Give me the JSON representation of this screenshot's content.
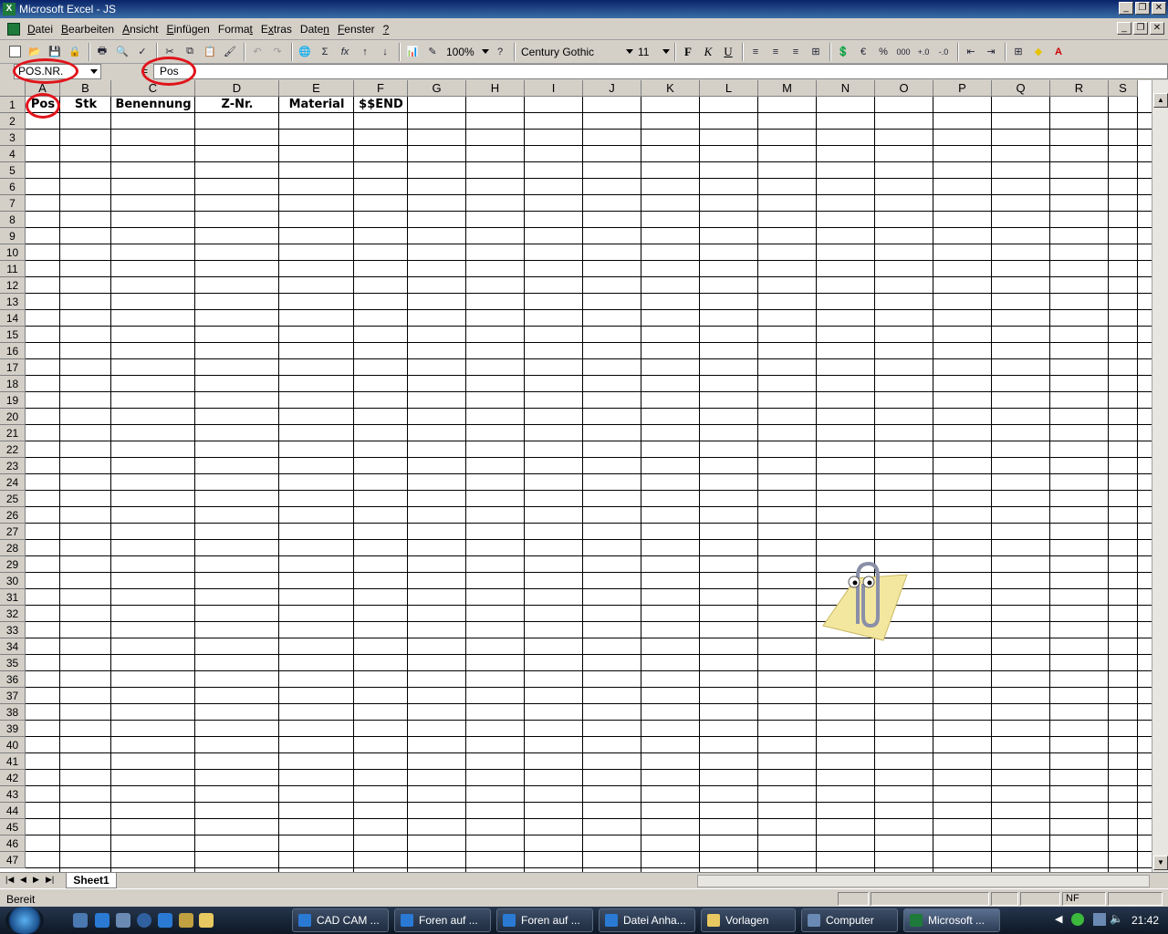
{
  "window": {
    "title": "Microsoft Excel - JS"
  },
  "menu": {
    "items": [
      {
        "pre": "",
        "u": "D",
        "post": "atei"
      },
      {
        "pre": "",
        "u": "B",
        "post": "earbeiten"
      },
      {
        "pre": "",
        "u": "A",
        "post": "nsicht"
      },
      {
        "pre": "",
        "u": "E",
        "post": "infügen"
      },
      {
        "pre": "Forma",
        "u": "t",
        "post": ""
      },
      {
        "pre": "E",
        "u": "x",
        "post": "tras"
      },
      {
        "pre": "Date",
        "u": "n",
        "post": ""
      },
      {
        "pre": "",
        "u": "F",
        "post": "enster"
      },
      {
        "pre": "",
        "u": "?",
        "post": ""
      }
    ]
  },
  "toolbar": {
    "zoom": "100%",
    "font_name": "Century Gothic",
    "font_size": "11",
    "bold_label": "F",
    "italic_label": "K",
    "underline_label": "U",
    "sum_label": "Σ",
    "fx_label": "fx",
    "euro_label": "€",
    "percent_label": "%",
    "thousands_label": "000"
  },
  "formula_bar": {
    "name_box": "POS.NR.",
    "equals": "=",
    "content": "Pos"
  },
  "columns": [
    "A",
    "B",
    "C",
    "D",
    "E",
    "F",
    "G",
    "H",
    "I",
    "J",
    "K",
    "L",
    "M",
    "N",
    "O",
    "P",
    "Q",
    "R",
    "S"
  ],
  "header_row": [
    "Pos",
    "Stk",
    "Benennung",
    "Z-Nr.",
    "Material",
    "$$END"
  ],
  "rows": [
    "1",
    "2",
    "3",
    "4",
    "5",
    "6",
    "7",
    "8",
    "9",
    "10",
    "11",
    "12",
    "13",
    "14",
    "15",
    "16",
    "17",
    "18",
    "19",
    "20",
    "21",
    "22",
    "23",
    "24",
    "25",
    "26",
    "27",
    "28",
    "29",
    "30",
    "31",
    "32",
    "33",
    "34",
    "35",
    "36",
    "37",
    "38",
    "39",
    "40",
    "41",
    "42",
    "43",
    "44",
    "45",
    "46",
    "47"
  ],
  "sheet_tabs": [
    "Sheet1"
  ],
  "status": {
    "text": "Bereit",
    "indicator": "NF"
  },
  "taskbar": {
    "buttons": [
      "CAD CAM ...",
      "Foren auf ...",
      "Foren auf ...",
      "Datei Anha...",
      "Vorlagen",
      "Computer",
      "Microsoft ..."
    ],
    "clock": "21:42"
  },
  "colors": {
    "accent_ring": "#e0141b",
    "excel_green": "#1d7a3a"
  }
}
